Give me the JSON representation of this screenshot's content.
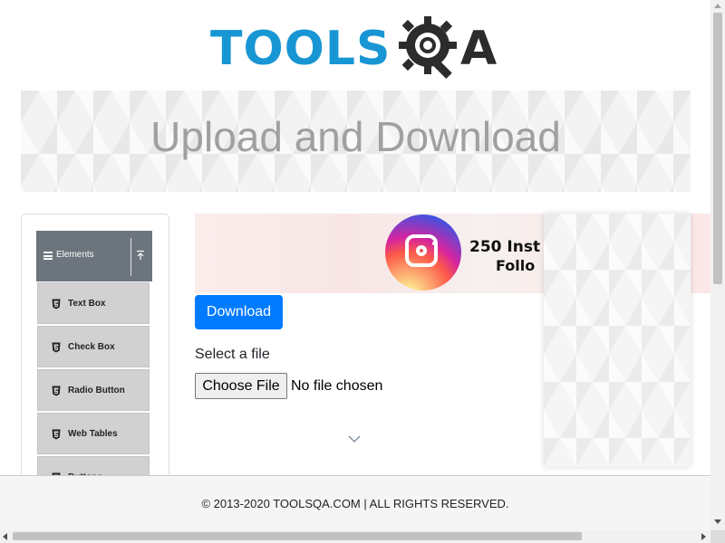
{
  "header": {
    "logo_text": "TOOLS",
    "logo_suffix": "A",
    "logo_icon": "gear-magnifier-icon",
    "brand_color": "#1896d3"
  },
  "banner": {
    "title": "Upload and Download"
  },
  "sidebar": {
    "group": {
      "label": "Elements",
      "icon": "hamburger-icon",
      "collapse_icon": "collapse-up-icon"
    },
    "items": [
      {
        "label": "Text Box",
        "icon": "html5-icon"
      },
      {
        "label": "Check Box",
        "icon": "html5-icon"
      },
      {
        "label": "Radio Button",
        "icon": "html5-icon"
      },
      {
        "label": "Web Tables",
        "icon": "html5-icon"
      },
      {
        "label": "Buttons",
        "icon": "html5-icon"
      }
    ]
  },
  "ad": {
    "line1": "250 Inst",
    "line2": "Follo",
    "icon": "instagram-icon"
  },
  "main": {
    "download_label": "Download",
    "select_label": "Select a file",
    "choose_file_label": "Choose File",
    "file_status": "No file chosen"
  },
  "footer": {
    "text": "© 2013-2020 TOOLSQA.COM | ALL RIGHTS RESERVED."
  },
  "colors": {
    "primary_button": "#007bff",
    "group_header": "#6c757d",
    "menu_item": "#d1d1d1"
  }
}
